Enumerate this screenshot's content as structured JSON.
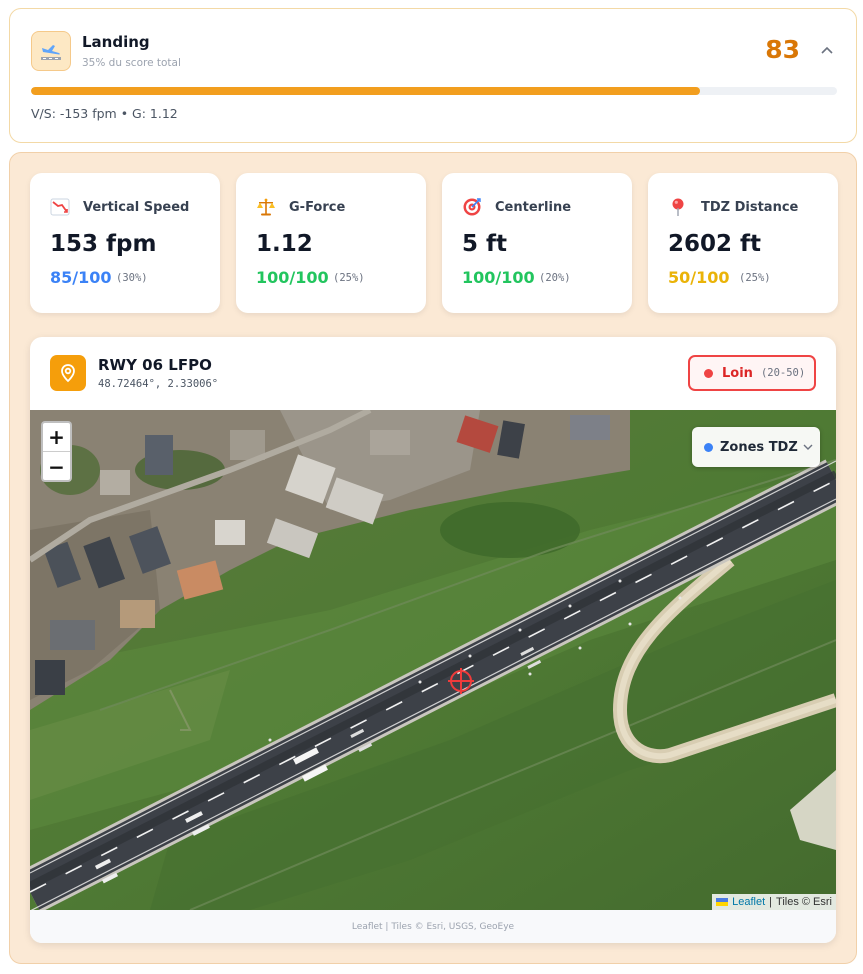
{
  "header": {
    "title": "Landing",
    "subtitle": "35% du score total",
    "score": "83",
    "progress_percent": 83,
    "meta": "V/S: -153 fpm • G: 1.12",
    "icon": "landing-plane-icon"
  },
  "metrics": [
    {
      "label": "Vertical Speed",
      "value": "153 fpm",
      "score": "85/100",
      "weight": "(30%)",
      "score_color": "#3b82f6",
      "icon": "chart-down-icon"
    },
    {
      "label": "G-Force",
      "value": "1.12",
      "score": "100/100",
      "weight": "(25%)",
      "score_color": "#22c55e",
      "icon": "balance-scale-icon"
    },
    {
      "label": "Centerline",
      "value": "5 ft",
      "score": "100/100",
      "weight": "(20%)",
      "score_color": "#22c55e",
      "icon": "target-icon"
    },
    {
      "label": "TDZ Distance",
      "value": "2602 ft",
      "score": "50/100",
      "weight": "(25%)",
      "score_color": "#eab308",
      "icon": "pushpin-icon"
    }
  ],
  "map": {
    "runway": "RWY 06 LFPO",
    "coords": "48.72464°, 2.33006°",
    "status": {
      "label": "Loin",
      "range": "(20-50)",
      "color": "#ef4444"
    },
    "zoom_in": "+",
    "zoom_out": "−",
    "layer_label": "Zones TDZ",
    "attribution": {
      "link": "Leaflet",
      "sep": " | ",
      "tiles": "Tiles © Esri"
    },
    "footer": "Leaflet | Tiles © Esri, USGS, GeoEye"
  },
  "colors": {
    "accent_orange": "#f59e0b",
    "score_orange": "#d97706",
    "panel_bg": "#fbe9d5"
  }
}
